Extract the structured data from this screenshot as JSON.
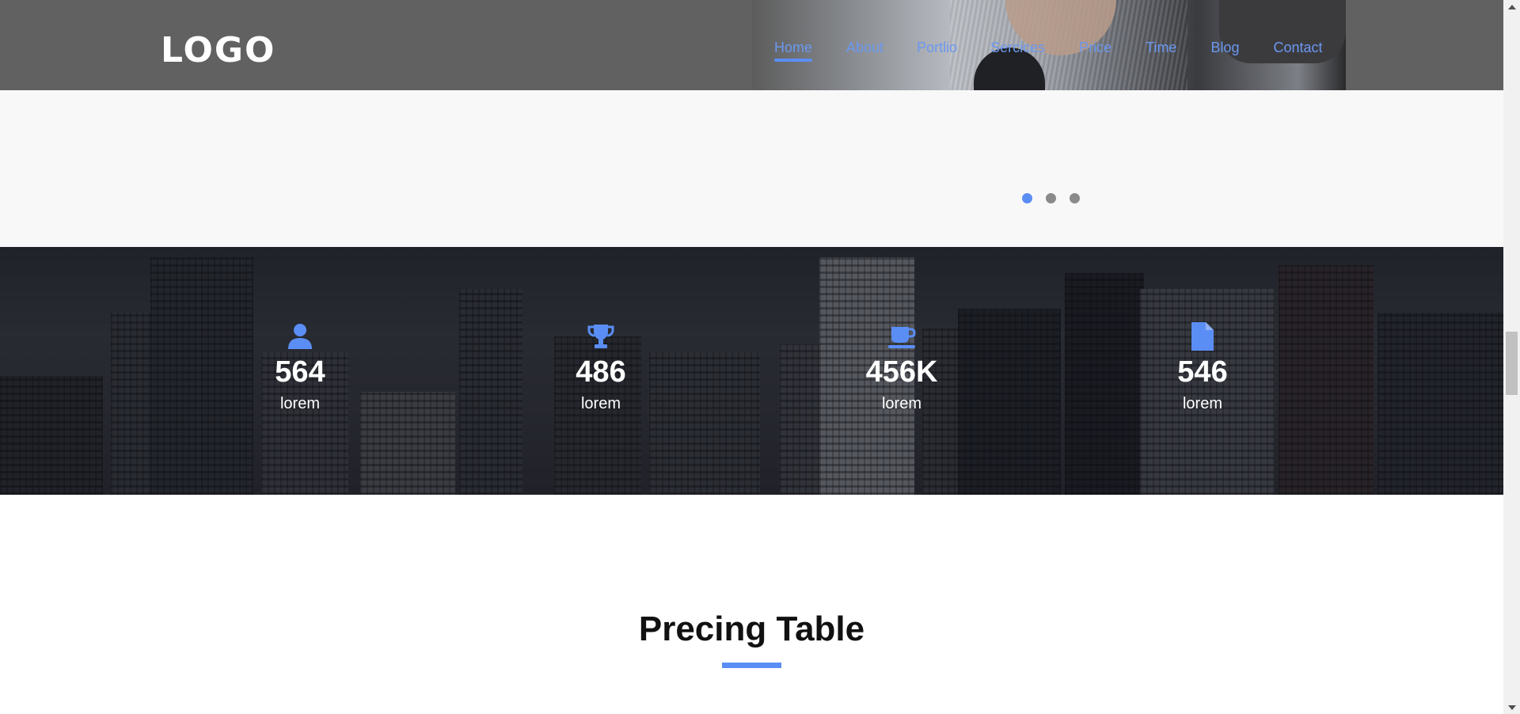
{
  "header": {
    "logo": "LOGO",
    "nav": [
      {
        "label": "Home",
        "active": true
      },
      {
        "label": "About",
        "active": false
      },
      {
        "label": "Portlio",
        "active": false
      },
      {
        "label": "Sercices",
        "active": false
      },
      {
        "label": "Price",
        "active": false
      },
      {
        "label": "Time",
        "active": false
      },
      {
        "label": "Blog",
        "active": false
      },
      {
        "label": "Contact",
        "active": false
      }
    ]
  },
  "carousel": {
    "slide_count": 3,
    "active_index": 0
  },
  "stats": [
    {
      "icon": "user-icon",
      "value": "564",
      "label": "lorem"
    },
    {
      "icon": "trophy-icon",
      "value": "486",
      "label": "lorem"
    },
    {
      "icon": "coffee-icon",
      "value": "456K",
      "label": "lorem"
    },
    {
      "icon": "document-icon",
      "value": "546",
      "label": "lorem"
    }
  ],
  "pricing": {
    "title": "Precing Table"
  },
  "colors": {
    "accent": "#5b8ef5",
    "header_bg": "#616161",
    "nav_text": "#6b98f0"
  }
}
